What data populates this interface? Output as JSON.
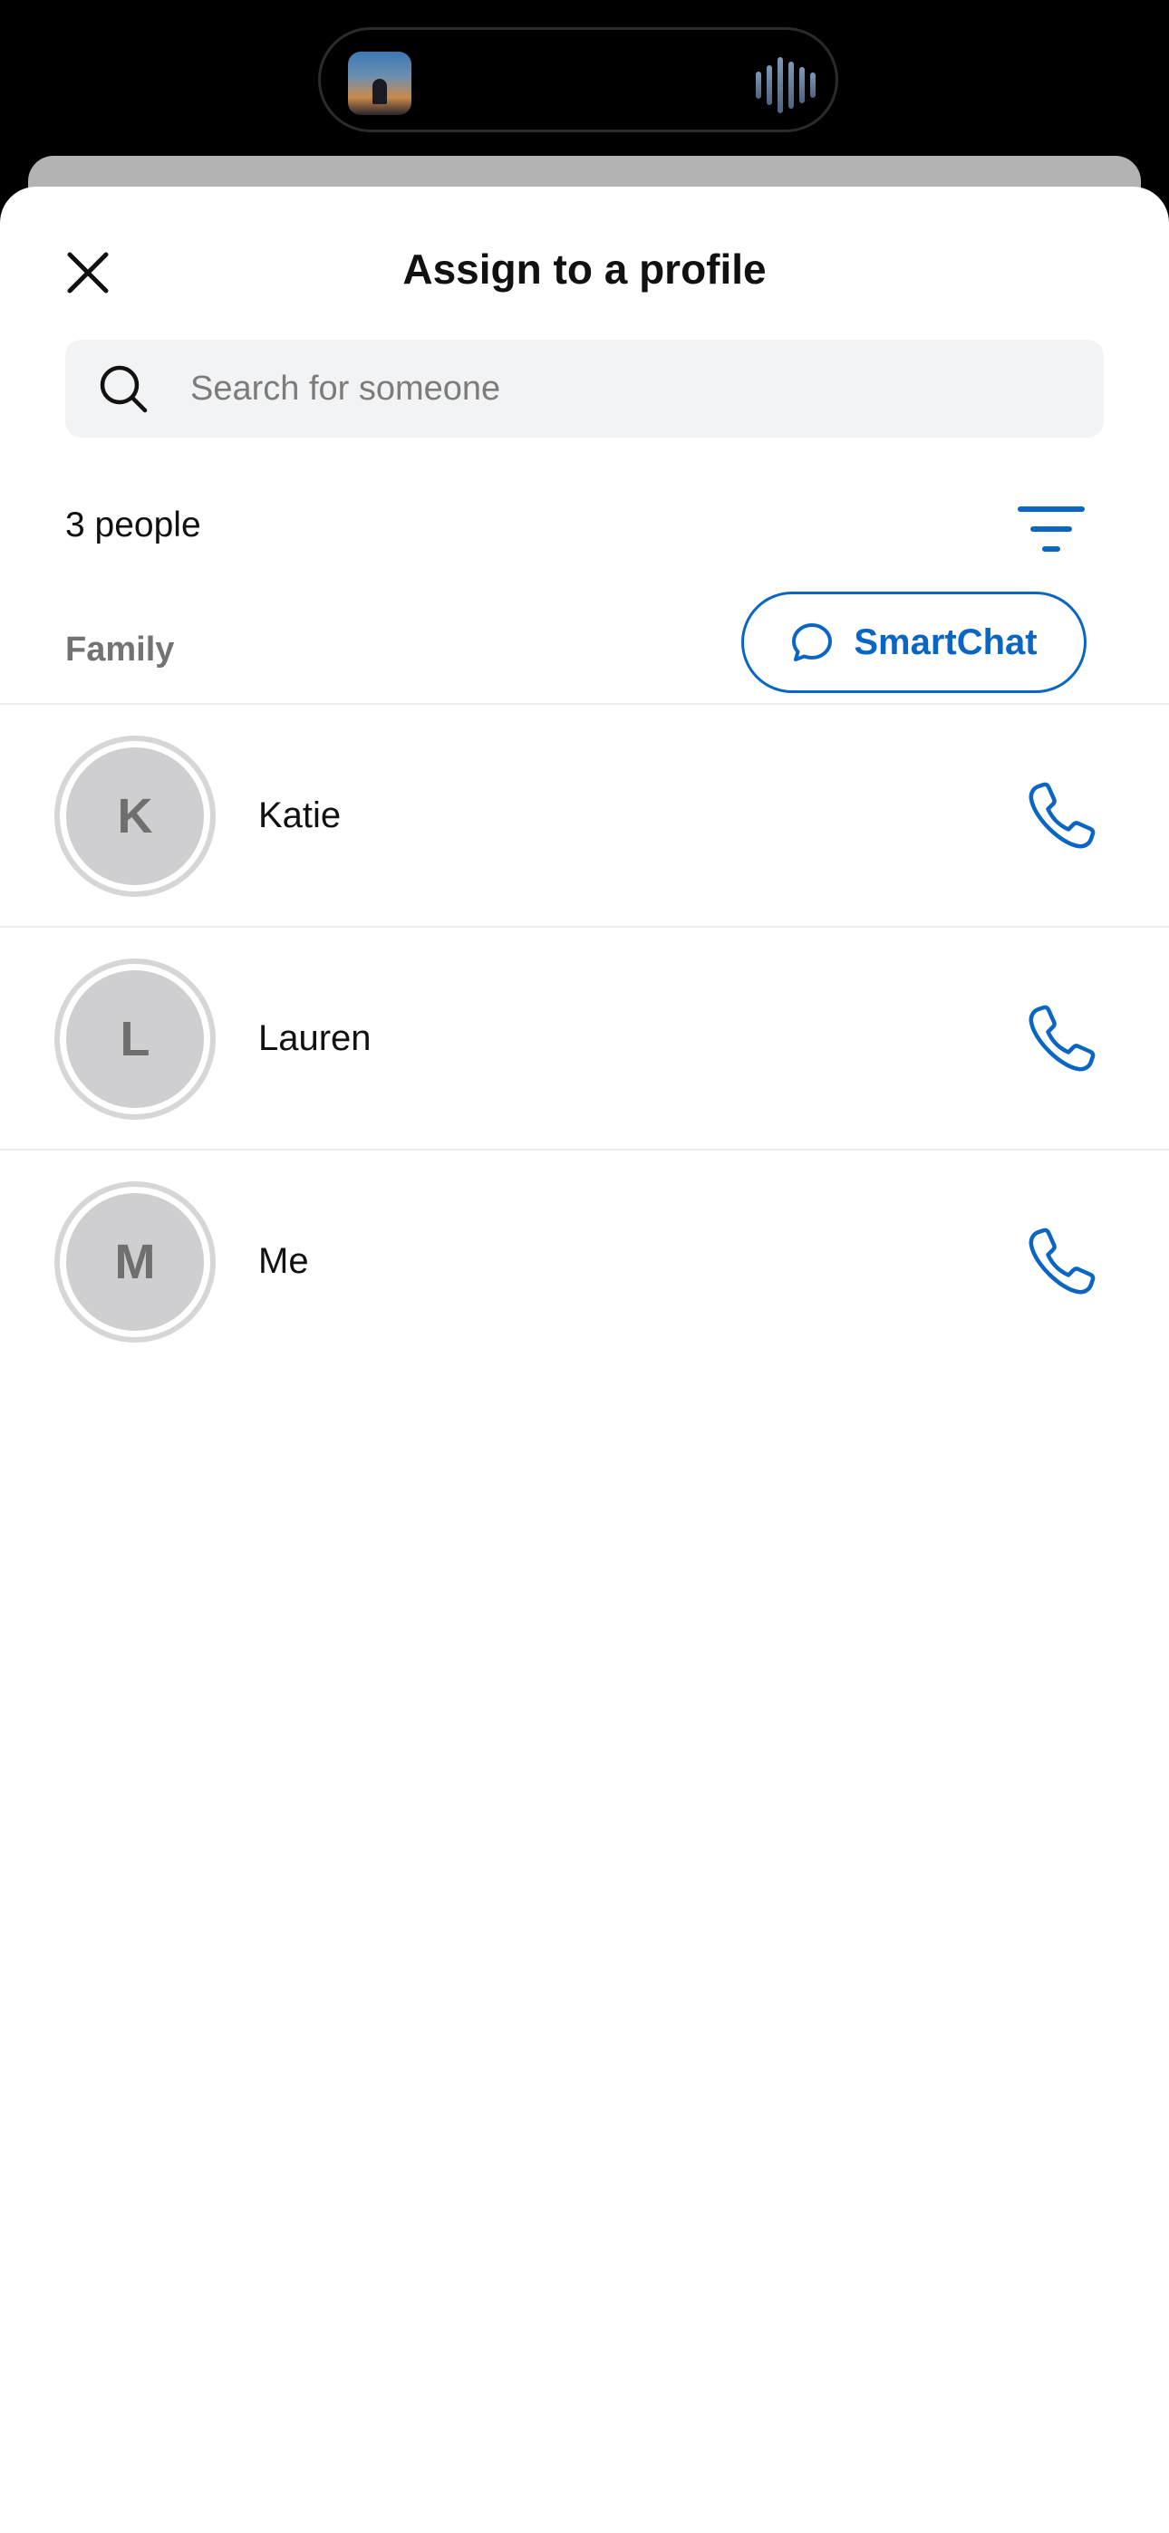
{
  "header": {
    "title": "Assign to a profile"
  },
  "search": {
    "placeholder": "Search for someone",
    "value": ""
  },
  "summary": {
    "count_text": "3 people"
  },
  "group": {
    "label": "Family"
  },
  "smartchat": {
    "label": "SmartChat"
  },
  "people": [
    {
      "initial": "K",
      "name": "Katie"
    },
    {
      "initial": "L",
      "name": "Lauren"
    },
    {
      "initial": "M",
      "name": "Me"
    }
  ],
  "colors": {
    "accent": "#0a66c2",
    "avatar_bg": "#cfcfd1",
    "search_bg": "#f2f3f4",
    "muted_text": "#737373"
  },
  "icons": {
    "close": "close-icon",
    "search": "search-icon",
    "filter": "filter-icon",
    "smartchat": "chat-bubble-icon",
    "call": "phone-icon"
  }
}
